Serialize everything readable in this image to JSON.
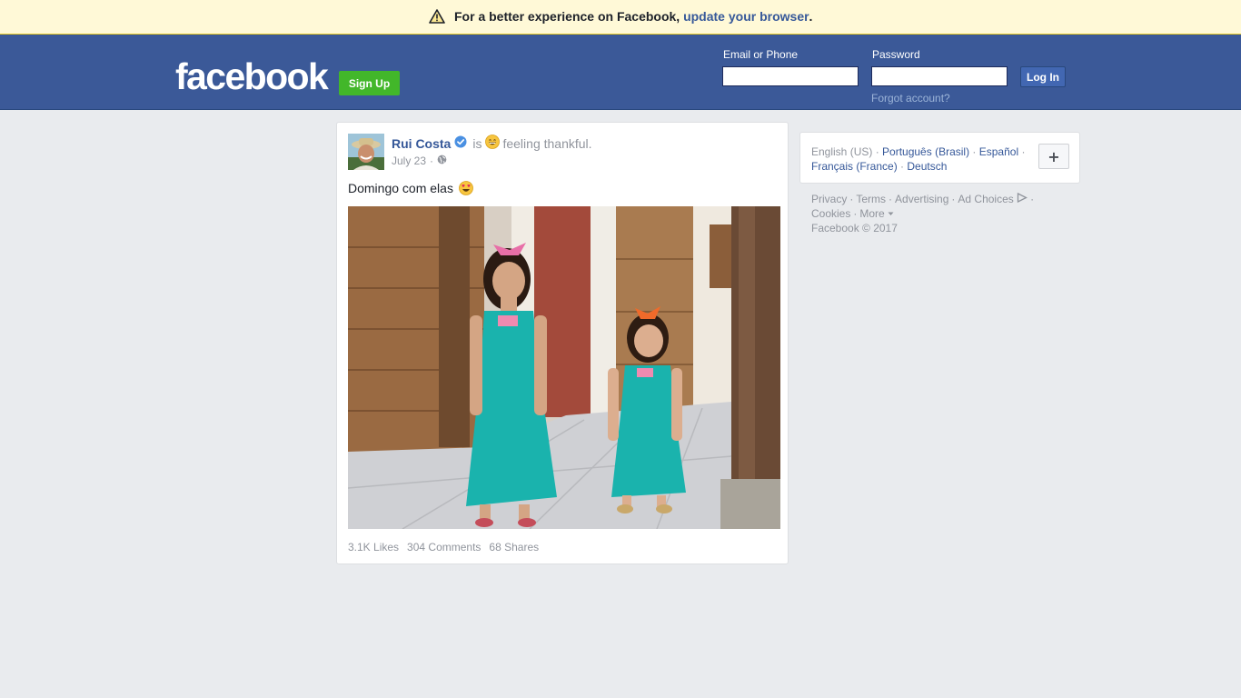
{
  "banner": {
    "message": "For a better experience on Facebook,",
    "link": "update your browser",
    "period": "."
  },
  "header": {
    "logo": "facebook",
    "signup_label": "Sign Up",
    "email_label": "Email or Phone",
    "email_value": "",
    "password_label": "Password",
    "password_value": "",
    "login_label": "Log In",
    "forgot_label": "Forgot account?",
    "brand_color": "#3b5998",
    "signup_color": "#42b72a"
  },
  "post": {
    "author": "Rui Costa",
    "verified": true,
    "is_text": "is",
    "feeling_text": "feeling thankful.",
    "feeling_icon": "grinning-emoji-icon",
    "date": "July 23",
    "date_separator": "·",
    "privacy_icon": "globe-icon",
    "text": "Domingo com elas",
    "text_emoji": "heart-eyes-emoji-icon",
    "stats": {
      "likes": "3.1K Likes",
      "comments": "304 Comments",
      "shares": "68 Shares"
    }
  },
  "sidebar": {
    "current_language": "English (US)",
    "languages": [
      "Português (Brasil)",
      "Español",
      "Français (France)",
      "Deutsch"
    ],
    "more_languages_label": "+",
    "footer_links": [
      "Privacy",
      "Terms",
      "Advertising",
      "Ad Choices",
      "Cookies",
      "More"
    ],
    "copyright": "Facebook © 2017"
  }
}
